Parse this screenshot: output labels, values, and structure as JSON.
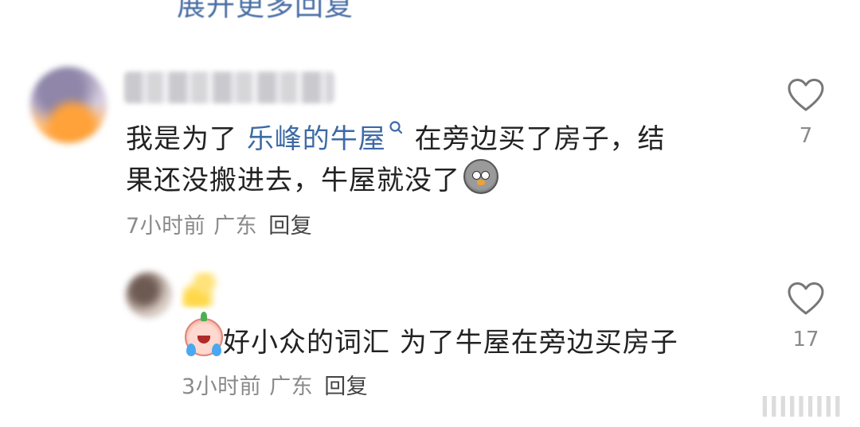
{
  "top_partial_text": "展开更多回复",
  "comments": [
    {
      "text_line1_prefix": "我是为了 ",
      "link_text": "乐峰的牛屋",
      "text_line1_suffix": " 在旁边买了房子，结",
      "text_line2": "果还没搬进去，牛屋就没了",
      "time": "7小时前",
      "location": "广东",
      "reply_label": "回复",
      "likes": "7",
      "emoji": "sad-bird-emoji"
    },
    {
      "text": "好小众的词汇 为了牛屋在旁边买房子",
      "time": "3小时前",
      "location": "广东",
      "reply_label": "回复",
      "likes": "17",
      "emoji": "crying-face-emoji"
    }
  ],
  "watermark": "ǀǀǀǀǀǀǀǀǀ",
  "colors": {
    "link": "#3d6aa6",
    "meta": "#8a8a8a",
    "text": "#222222"
  }
}
